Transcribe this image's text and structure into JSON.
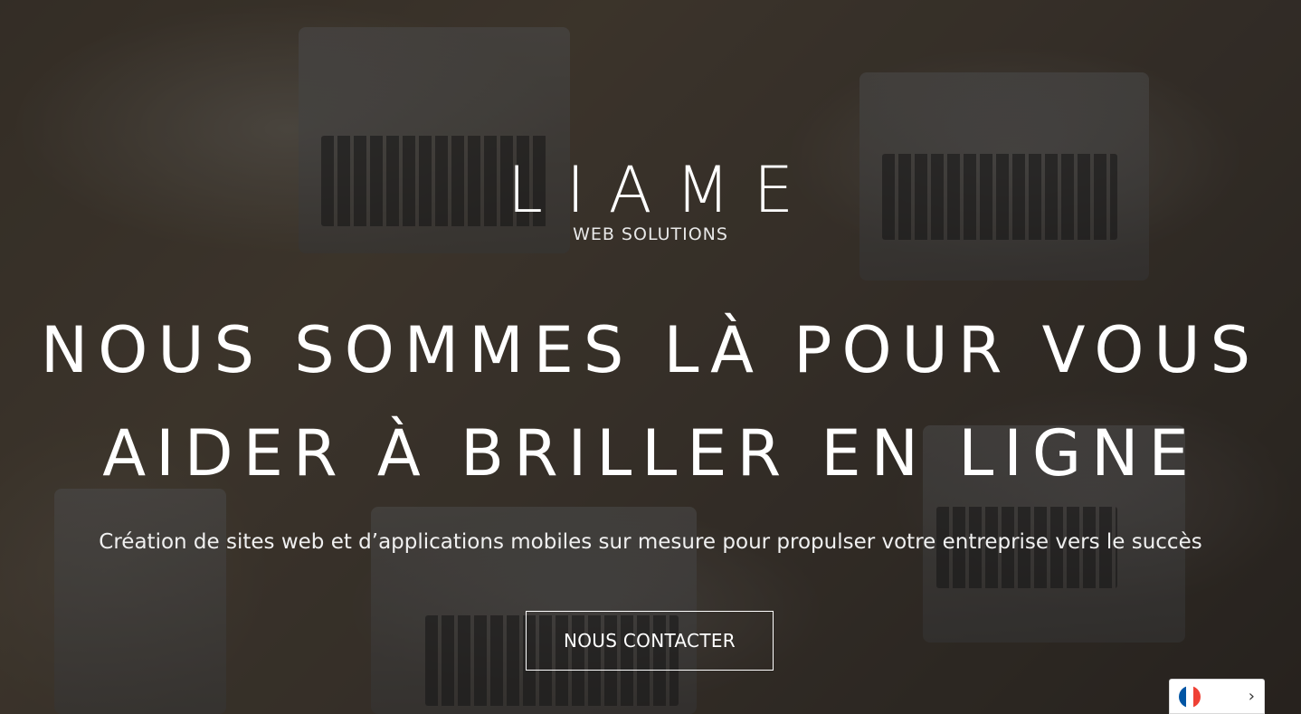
{
  "brand": {
    "logo_main": "LIAME",
    "logo_sub": "WEB SOLUTIONS"
  },
  "hero": {
    "headline_line1": "NOUS SOMMES LÀ POUR VOUS",
    "headline_line2": "AIDER À BRILLER EN LIGNE",
    "tagline": "Création de sites web et d’applications mobiles sur mesure pour propulser votre entreprise vers le succès",
    "cta_label": "NOUS CONTACTER"
  },
  "language_switcher": {
    "current_flag_icon": "france-flag-icon",
    "flag_colors": [
      "#0055a4",
      "#ffffff",
      "#ef4135"
    ],
    "chevron_icon": "chevron-right-icon"
  },
  "colors": {
    "text": "#ffffff",
    "overlay": "rgba(20,18,16,0.55)"
  }
}
